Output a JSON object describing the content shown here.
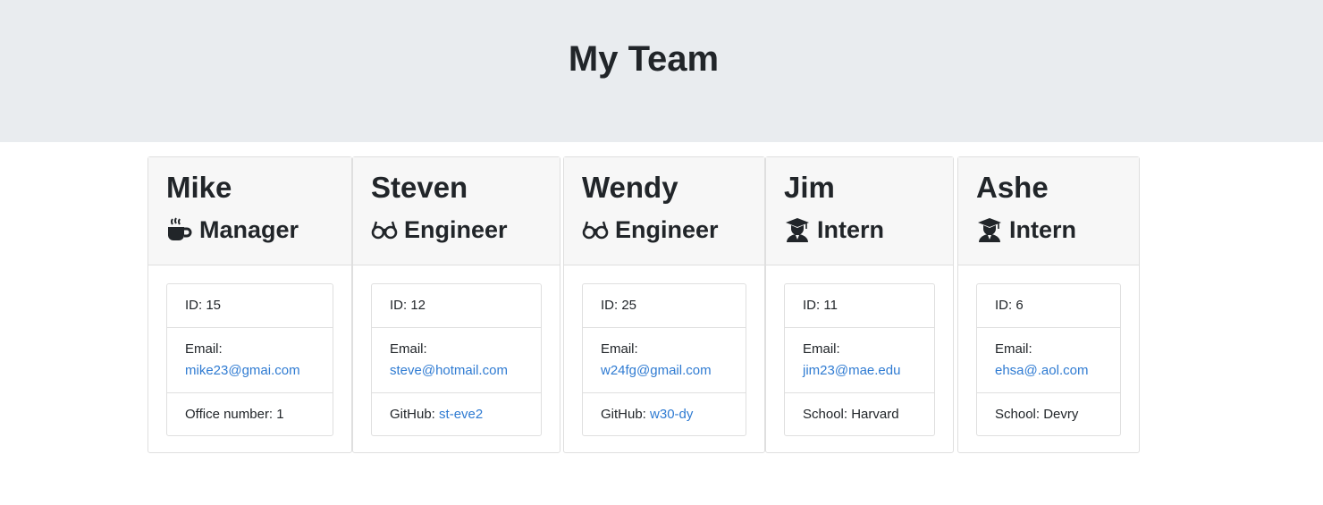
{
  "header": {
    "title": "My Team"
  },
  "team": [
    {
      "name": "Mike",
      "role": "Manager",
      "icon": "coffee-icon",
      "id_text": "ID: 15",
      "email_label": "Email:",
      "email": "mike23@gmai.com",
      "extra_label": "Office number: 1",
      "extra_value": ""
    },
    {
      "name": "Steven",
      "role": "Engineer",
      "icon": "glasses-icon",
      "id_text": "ID: 12",
      "email_label": "Email:",
      "email": "steve@hotmail.com",
      "extra_label": "GitHub: ",
      "extra_value": "st-eve2"
    },
    {
      "name": "Wendy",
      "role": "Engineer",
      "icon": "glasses-icon",
      "id_text": "ID: 25",
      "email_label": "Email:",
      "email": "w24fg@gmail.com",
      "extra_label": "GitHub: ",
      "extra_value": "w30-dy"
    },
    {
      "name": "Jim",
      "role": "Intern",
      "icon": "graduate-icon",
      "id_text": "ID: 11",
      "email_label": "Email:",
      "email": "jim23@mae.edu",
      "extra_label": "School: Harvard",
      "extra_value": ""
    },
    {
      "name": "Ashe",
      "role": "Intern",
      "icon": "graduate-icon",
      "id_text": "ID: 6",
      "email_label": "Email:",
      "email": "ehsa@.aol.com",
      "extra_label": "School: Devry",
      "extra_value": ""
    }
  ],
  "colors": {
    "header_bg": "#e9ecef",
    "card_header_bg": "#f7f7f7",
    "link": "#2f7bd2",
    "text": "#212529"
  }
}
